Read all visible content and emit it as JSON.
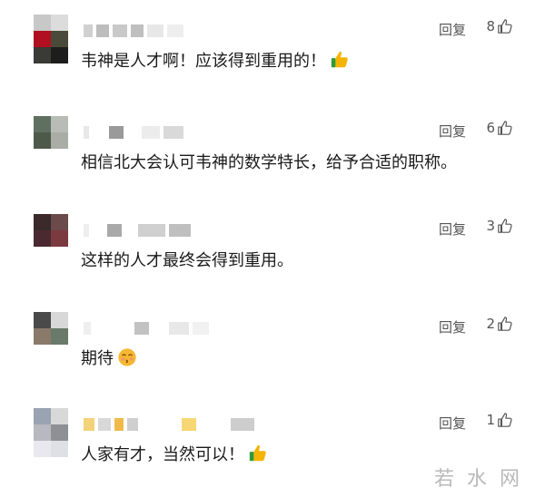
{
  "comments": [
    {
      "text": "韦神是人才啊！应该得到重用的！",
      "reply_label": "回复",
      "likes": "8",
      "emoji": "thumbs-up-emoji"
    },
    {
      "text": "相信北大会认可韦神的数学特长，给予合适的职称。",
      "reply_label": "回复",
      "likes": "6",
      "emoji": ""
    },
    {
      "text": "这样的人才最终会得到重用。",
      "reply_label": "回复",
      "likes": "3",
      "emoji": ""
    },
    {
      "text": "期待",
      "reply_label": "回复",
      "likes": "2",
      "emoji": "kissing-face-emoji"
    },
    {
      "text": "人家有才，当然可以！",
      "reply_label": "回复",
      "likes": "1",
      "emoji": "thumbs-up-emoji"
    }
  ],
  "watermark": "若水网",
  "icons": {
    "like": "thumbs-up-outline-icon"
  },
  "colors": {
    "emoji_thumb": "#f5b400",
    "emoji_cuff": "#2e9b3a",
    "emoji_face": "#f6b733"
  }
}
